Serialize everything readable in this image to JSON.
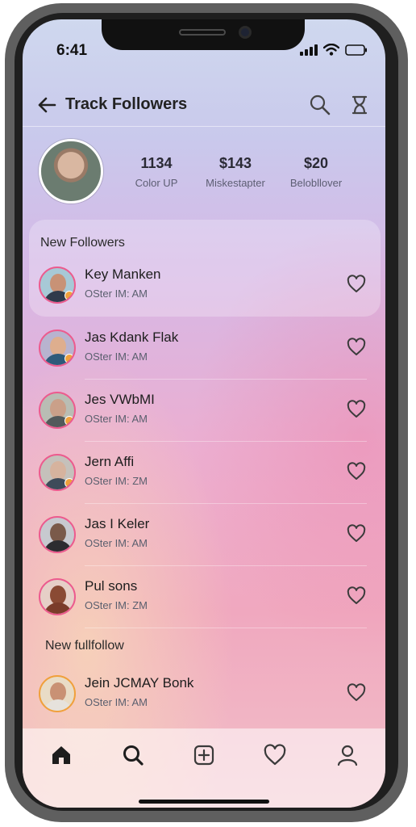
{
  "status": {
    "time": "6:41"
  },
  "header": {
    "title": "Track Followers"
  },
  "profile": {
    "stats": [
      {
        "value": "1134",
        "label": "Color UP"
      },
      {
        "value": "$143",
        "label": "Miskestapter"
      },
      {
        "value": "$20",
        "label": "Belobllover"
      }
    ]
  },
  "sections": {
    "new_followers": "New Followers",
    "new_fullfollow": "New fullfollow"
  },
  "followers": [
    {
      "name": "Key Manken",
      "sub": "OSter IM: AM"
    },
    {
      "name": "Jas Kdank Flak",
      "sub": "OSter IM: AM"
    },
    {
      "name": "Jes VWbMI",
      "sub": "OSter IM: AM"
    },
    {
      "name": "Jern Affi",
      "sub": "OSter IM: ZM"
    },
    {
      "name": "Jas I Keler",
      "sub": "OSter IM: AM"
    },
    {
      "name": "Pul sons",
      "sub": "OSter IM: ZM"
    }
  ],
  "fullfollow": [
    {
      "name": "Jein JCMAY Bonk",
      "sub": "OSter IM: AM"
    }
  ],
  "icons": {
    "back": "arrow-left-icon",
    "search": "search-icon",
    "hourglass": "hourglass-icon",
    "heart": "heart-outline-icon",
    "tabs": [
      "home-icon",
      "search-icon",
      "plus-square-icon",
      "heart-icon",
      "user-icon"
    ]
  },
  "colors": {
    "accent_ring": "#ec5b8e",
    "badge": "#f0a03c",
    "text_primary": "#1d1d1d"
  }
}
